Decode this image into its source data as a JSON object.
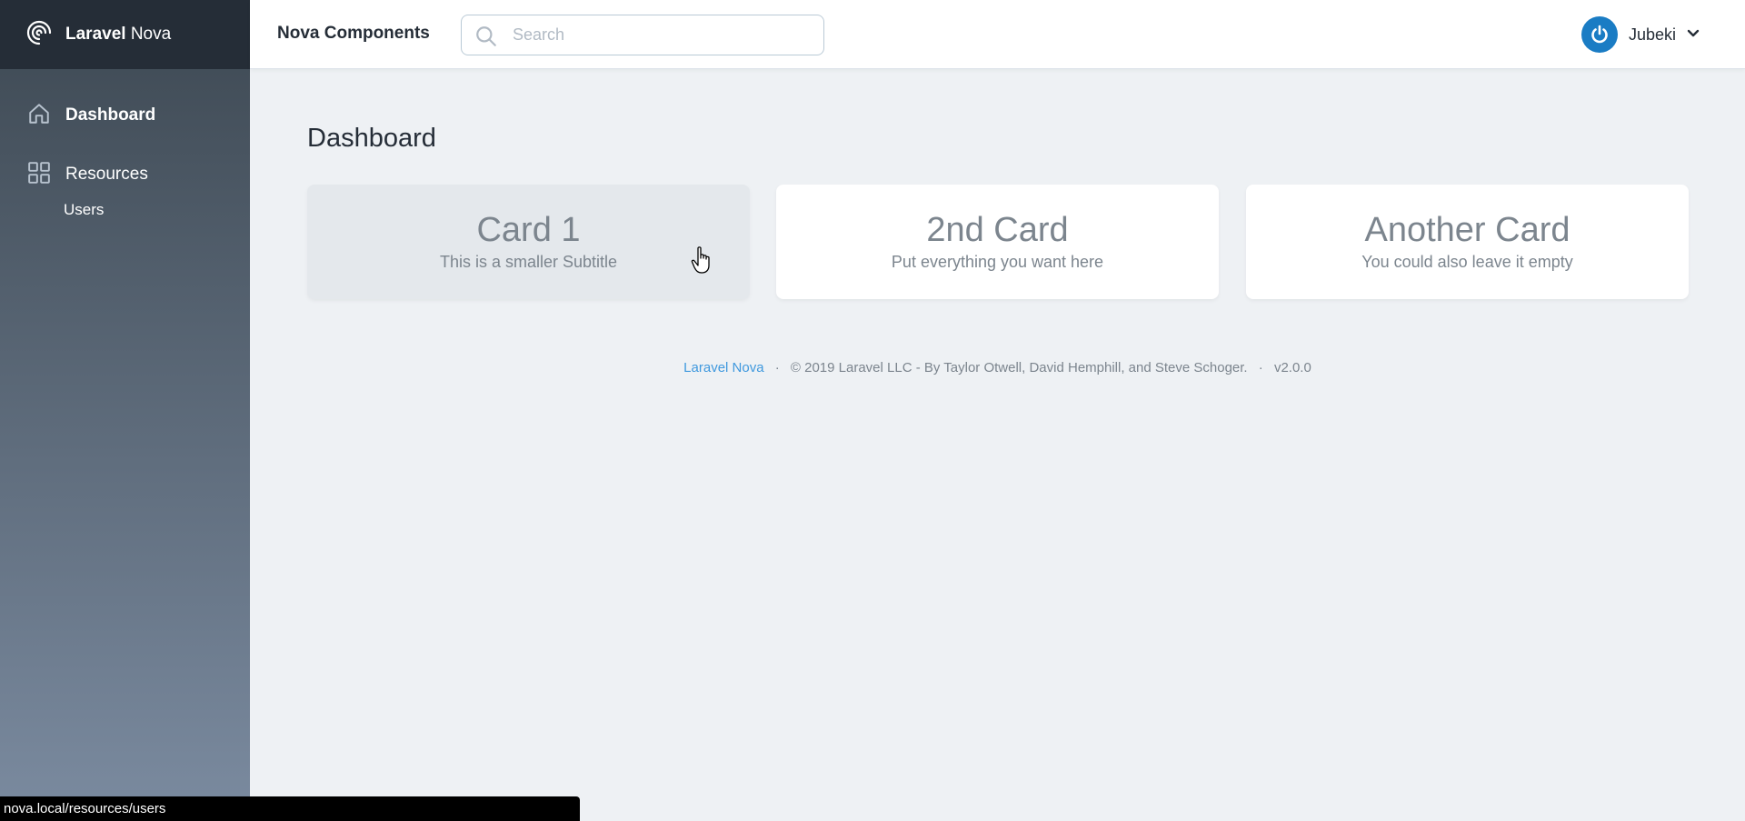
{
  "brand": {
    "bold": "Laravel",
    "light": "Nova",
    "icon": "nova-logo-icon"
  },
  "sidebar": {
    "items": [
      {
        "label": "Dashboard",
        "icon": "home-icon",
        "active": true
      },
      {
        "label": "Resources",
        "icon": "grid-icon",
        "active": false
      }
    ],
    "sub_items": [
      {
        "label": "Users"
      }
    ]
  },
  "header": {
    "title": "Nova Components",
    "search_placeholder": "Search",
    "user_name": "Jubeki"
  },
  "main": {
    "page_title": "Dashboard",
    "cards": [
      {
        "title": "Card 1",
        "subtitle": "This is a smaller Subtitle"
      },
      {
        "title": "2nd Card",
        "subtitle": "Put everything you want here"
      },
      {
        "title": "Another Card",
        "subtitle": "You could also leave it empty"
      }
    ]
  },
  "footer": {
    "link": "Laravel Nova",
    "separator": "·",
    "copyright": "© 2019 Laravel LLC - By Taylor Otwell, David Hemphill, and Steve Schoger.",
    "version": "v2.0.0"
  },
  "status_bar": {
    "url": "nova.local/resources/users"
  },
  "colors": {
    "sidebar_top": "#3d4852",
    "sidebar_bottom": "#7b8ba0",
    "brand_bg": "#252d37",
    "link": "#4099de",
    "avatar": "#1a7cc4",
    "page_bg": "#eef1f4"
  }
}
